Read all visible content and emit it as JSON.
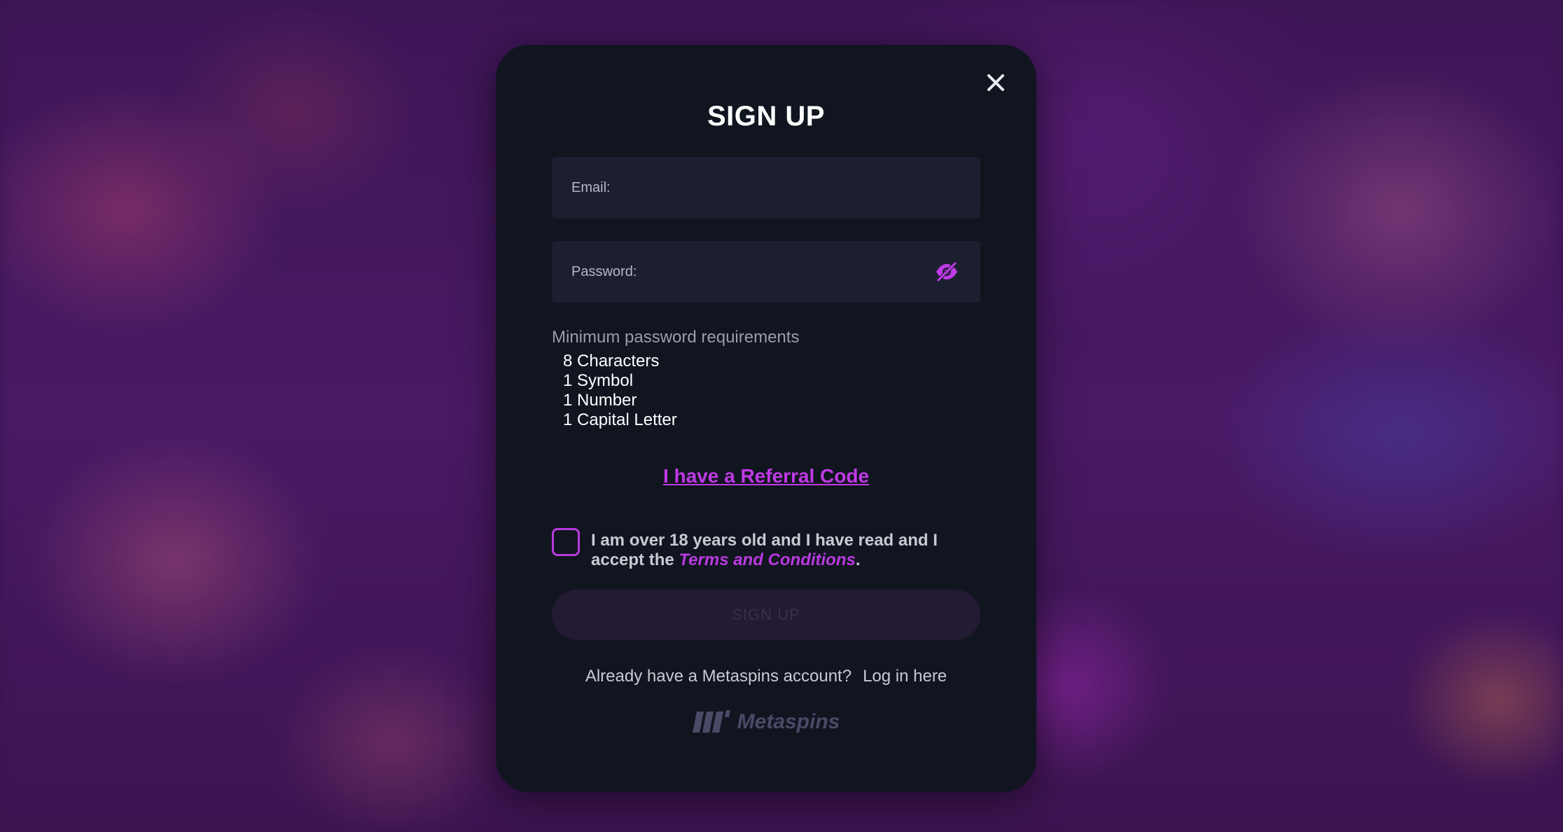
{
  "modal": {
    "title": "SIGN UP",
    "email_label": "Email:",
    "password_label": "Password:",
    "requirements_title": "Minimum password requirements",
    "requirements": [
      "8 Characters",
      "1 Symbol",
      "1 Number",
      "1 Capital Letter"
    ],
    "referral_link": "I have a Referral Code",
    "terms_prefix": "I am over 18 years old and I have read and I accept the ",
    "terms_link": "Terms and Conditions",
    "terms_suffix": ".",
    "submit_label": "SIGN UP",
    "login_prompt": "Already have a Metaspins account?",
    "login_link": "Log in here",
    "logo_text": "Metaspins"
  },
  "icons": {
    "close": "close-icon",
    "password_visibility": "eye-off-icon",
    "logo": "metaspins-logo-icon"
  },
  "colors": {
    "accent": "#c03ae6",
    "modal_bg": "#111520",
    "field_bg": "#1b1f30",
    "submit_bg_disabled": "#231a33"
  }
}
